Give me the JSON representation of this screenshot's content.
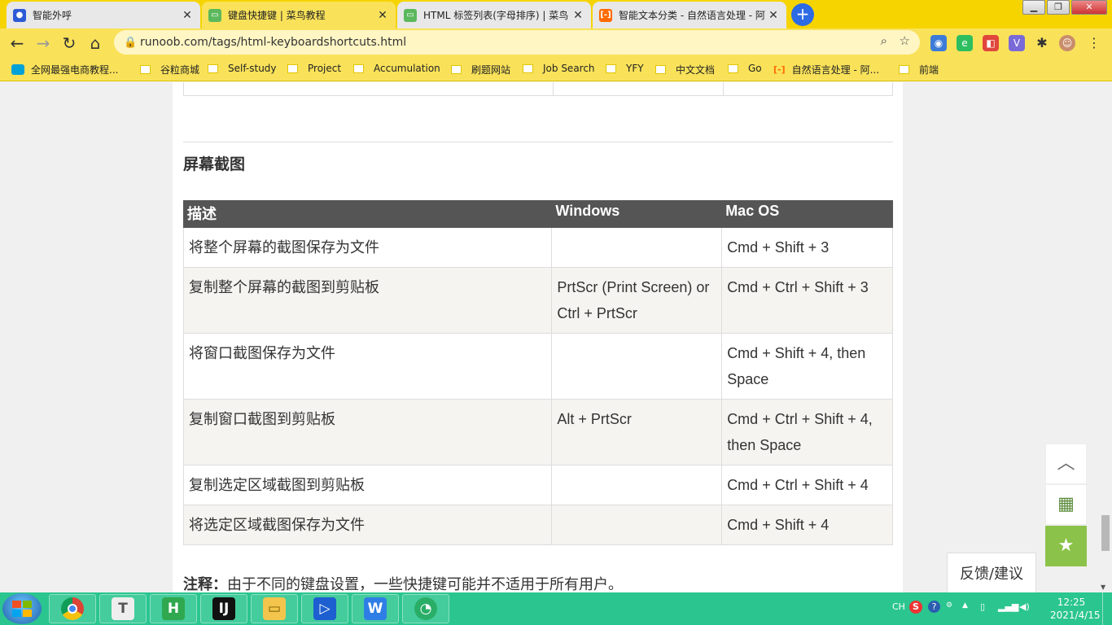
{
  "browser": {
    "tabs": [
      {
        "title": "智能外呼",
        "active": false
      },
      {
        "title": "键盘快捷键 | 菜鸟教程",
        "active": true
      },
      {
        "title": "HTML 标签列表(字母排序) | 菜鸟",
        "active": false
      },
      {
        "title": "智能文本分类 - 自然语言处理 - 阿",
        "active": false
      }
    ],
    "new_tab_label": "+",
    "url": "runoob.com/tags/html-keyboardshortcuts.html",
    "bookmarks": [
      "全网最强电商教程...",
      "谷粒商城",
      "Self-study",
      "Project",
      "Accumulation",
      "刷题网站",
      "Job Search",
      "YFY",
      "中文文档",
      "Go",
      "自然语言处理 - 阿...",
      "前端"
    ]
  },
  "page": {
    "section_title": "屏幕截图",
    "table": {
      "headers": [
        "描述",
        "Windows",
        "Mac OS"
      ],
      "rows": [
        {
          "desc": "将整个屏幕的截图保存为文件",
          "windows": "",
          "mac": "Cmd + Shift + 3"
        },
        {
          "desc": "复制整个屏幕的截图到剪贴板",
          "windows": "PrtScr (Print Screen) or Ctrl + PrtScr",
          "mac": "Cmd + Ctrl + Shift + 3"
        },
        {
          "desc": "将窗口截图保存为文件",
          "windows": "",
          "mac": "Cmd + Shift + 4, then Space"
        },
        {
          "desc": "复制窗口截图到剪贴板",
          "windows": "Alt + PrtScr",
          "mac": "Cmd + Ctrl + Shift + 4, then Space"
        },
        {
          "desc": "复制选定区域截图到剪贴板",
          "windows": "",
          "mac": "Cmd + Ctrl + Shift + 4"
        },
        {
          "desc": "将选定区域截图保存为文件",
          "windows": "",
          "mac": "Cmd + Shift + 4"
        }
      ]
    },
    "note_label": "注释：",
    "note_text": "由于不同的键盘设置，一些快捷键可能并不适用于所有用户。",
    "feedback_label": "反馈/建议"
  },
  "taskbar": {
    "apps": [
      "chrome",
      "typora",
      "hbuilder",
      "intellij",
      "explorer",
      "bilibili",
      "wps",
      "wechat"
    ],
    "lang": "CH",
    "time": "12:25",
    "date": "2021/4/15"
  },
  "colors": {
    "tabbar_bg": "#f6d400",
    "toolbar_bg": "#f9e25a",
    "table_header_bg": "#555555",
    "fav_button_bg": "#8bc34a",
    "taskbar_bg": "#2bc590"
  }
}
